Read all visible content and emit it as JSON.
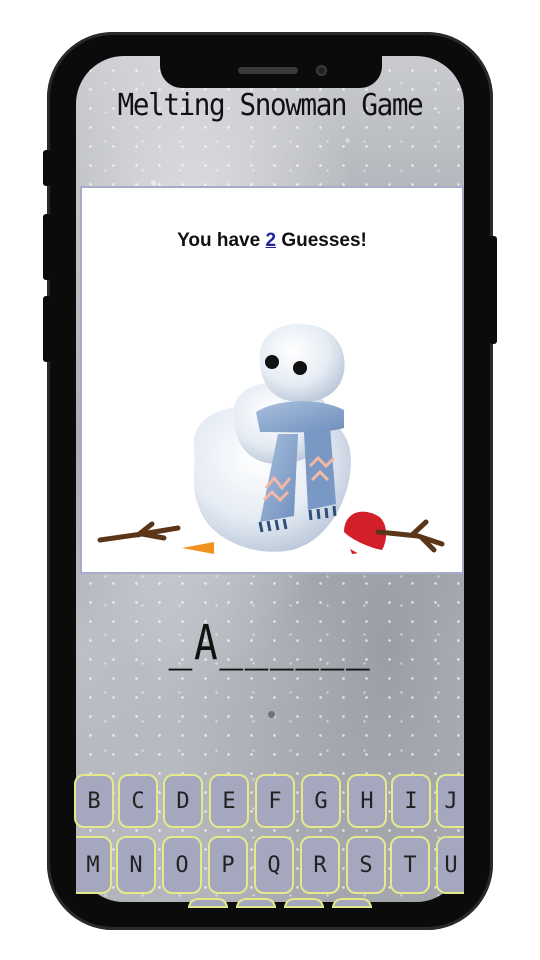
{
  "header": {
    "title": "Melting Snowman Game"
  },
  "status": {
    "prefix": "You have ",
    "count": "2",
    "suffix": " Guesses!"
  },
  "word": {
    "display": "_A______"
  },
  "keyboard": {
    "row1": [
      "B",
      "C",
      "D",
      "E",
      "F",
      "G",
      "H",
      "I",
      "J"
    ],
    "row2": [
      "M",
      "N",
      "O",
      "P",
      "Q",
      "R",
      "S",
      "T",
      "U"
    ]
  },
  "colors": {
    "key_fill": "#a5a7bf",
    "key_border": "#e6e98a",
    "count_link": "#22249b",
    "card_border": "#a9acc6"
  }
}
